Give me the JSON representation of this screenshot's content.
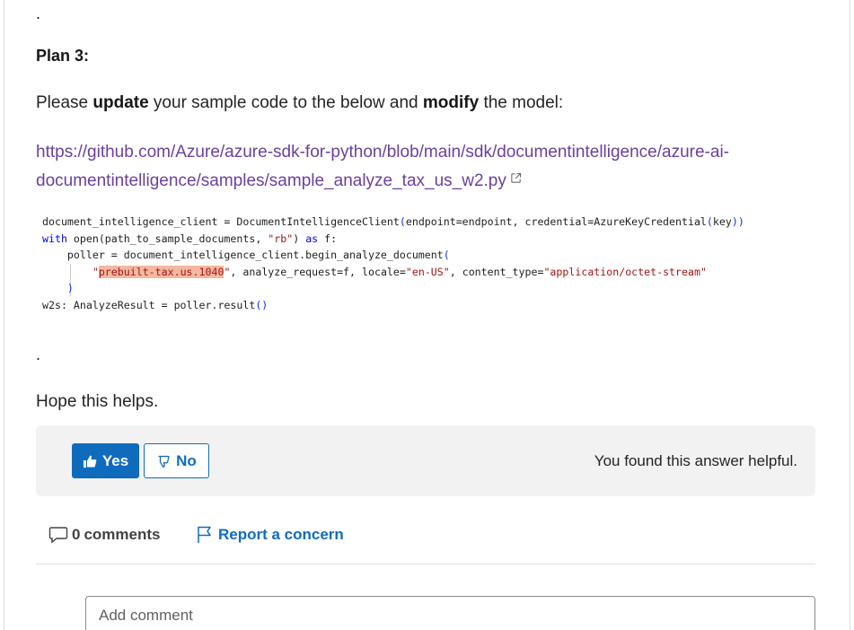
{
  "answer": {
    "dot_top": ".",
    "plan_heading": "Plan 3:",
    "intro": {
      "part1": "Please ",
      "bold1": "update",
      "part2": " your sample code to the below and ",
      "bold2": "modify",
      "part3": " the model:"
    },
    "link_text": "https://github.com/Azure/azure-sdk-for-python/blob/main/sdk/documentintelligence/azure-ai-documentintelligence/samples/sample_analyze_tax_us_w2.py",
    "link_icon": "external-link-icon",
    "code": {
      "line1_a": "document_intelligence_client = DocumentIntelligenceClient",
      "line1_b": "(",
      "line1_c": "endpoint=endpoint, credential=AzureKeyCredential",
      "line1_d": "(",
      "line1_e": "key",
      "line1_f": "))",
      "line2_kw": "with",
      "line2_a": " open(path_to_sample_documents, ",
      "line2_str": "\"rb\"",
      "line2_b": ") ",
      "line2_kw2": "as",
      "line2_c": " f:",
      "line3_a": "    poller = document_intelligence_client.begin_analyze_document",
      "line3_b": "(",
      "line4_indent": "        ",
      "line4_q1": "\"",
      "line4_hl": "prebuilt-tax.us.1040",
      "line4_q2": "\"",
      "line4_a": ", analyze_request=f, locale=",
      "line4_str1": "\"en-US\"",
      "line4_b": ", content_type=",
      "line4_str2": "\"application/octet-stream\"",
      "line5": "    )",
      "line6_a": "w2s: AnalyzeResult = poller.result",
      "line6_b": "()"
    },
    "dot_bottom": ".",
    "closing": "Hope this helps."
  },
  "feedback": {
    "yes_label": "Yes",
    "yes_icon": "thumbs-up-icon",
    "no_label": "No",
    "no_icon": "thumbs-down-icon",
    "status_text": "You found this answer helpful."
  },
  "actions": {
    "comments_count": "0",
    "comments_label": "comments",
    "comments_icon": "comment-icon",
    "report_label": "Report a concern",
    "report_icon": "flag-icon"
  },
  "comment_box": {
    "placeholder": "Add comment"
  },
  "colors": {
    "link": "#6b3fa0",
    "accent": "#0f6cbd",
    "highlight": "#f4b8a0",
    "string": "#a31515",
    "keyword": "#0000ff"
  }
}
